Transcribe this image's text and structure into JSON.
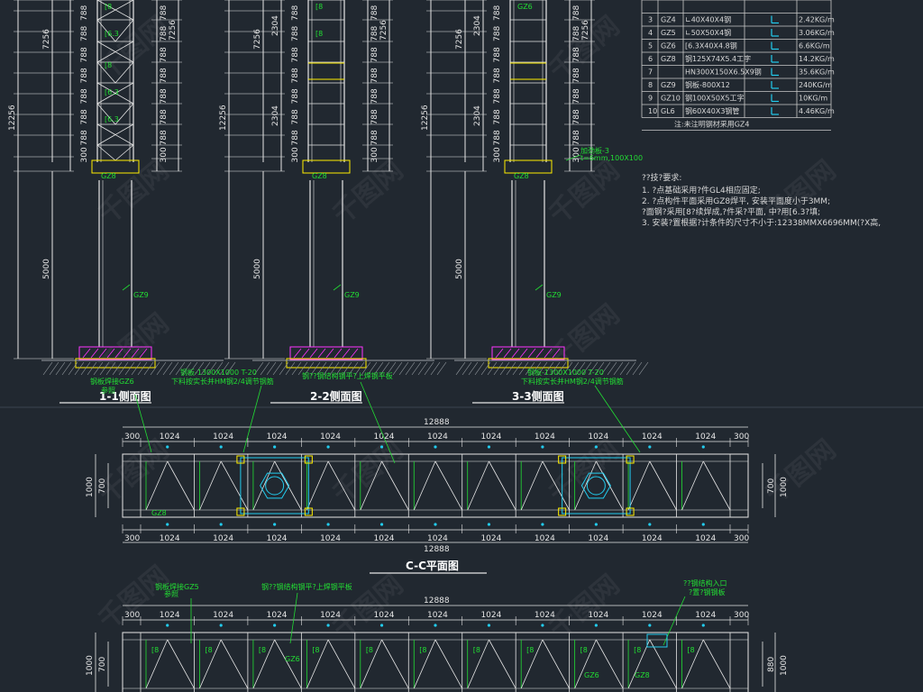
{
  "elevations": [
    {
      "id": "e1",
      "title": "1-1侧面图",
      "total": "12256",
      "upper": "7256",
      "lower": "5000",
      "col_label": "GZ9",
      "base_label": "GZ8",
      "marks": [
        "788",
        "788",
        "788",
        "788",
        "788",
        "788",
        "788",
        "300"
      ],
      "flanges": [
        "[8",
        "[6.3",
        "[8",
        "[6.3",
        "[6.3"
      ]
    },
    {
      "id": "e2",
      "title": "2-2侧面图",
      "total": "12256",
      "upper": "7256",
      "lower": "5000",
      "col_label": "GZ9",
      "base_label": "GZ8",
      "marks": [
        "788",
        "788",
        "788",
        "788",
        "788",
        "788",
        "788",
        "300"
      ],
      "seg_a": "2304",
      "seg_b": "2304",
      "flanges": [
        "[8",
        "[8"
      ]
    },
    {
      "id": "e3",
      "title": "3-3侧面图",
      "total": "12256",
      "upper": "7256",
      "lower": "5000",
      "col_label": "GZ9",
      "base_label": "GZ8",
      "marks": [
        "788",
        "788",
        "788",
        "788",
        "788",
        "788",
        "788",
        "300"
      ],
      "seg_a": "2304",
      "seg_b": "2304",
      "flanges": [
        "GZ6"
      ],
      "callout": "加劲板-3",
      "callout2": "t=6mm,100X100"
    }
  ],
  "table": {
    "rows": [
      {
        "no": "",
        "code": "",
        "spec": "",
        "unit": ""
      },
      {
        "no": "3",
        "code": "GZ4",
        "spec": "∟40X40X4钢",
        "unit": "2.42KG/m"
      },
      {
        "no": "4",
        "code": "GZ5",
        "spec": "∟50X50X4钢",
        "unit": "3.06KG/m"
      },
      {
        "no": "5",
        "code": "GZ6",
        "spec": "[6.3X40X4.8钢",
        "unit": "6.6KG/m"
      },
      {
        "no": "6",
        "code": "GZ8",
        "spec": "钢125X74X5.4工字",
        "unit": "14.2KG/m"
      },
      {
        "no": "7",
        "code": "",
        "spec": "HN300X150X6.5X9钢",
        "unit": "35.6KG/m"
      },
      {
        "no": "8",
        "code": "GZ9",
        "spec": "钢板-800X12",
        "unit": "240KG/m"
      },
      {
        "no": "9",
        "code": "GZ10",
        "spec": "钢100X50X5工字",
        "unit": "10KG/m"
      },
      {
        "no": "10",
        "code": "GL6",
        "spec": "钢60X40X3钢管",
        "unit": "4.46KG/m"
      }
    ],
    "footer": "注:未注明钢材采用GZ4"
  },
  "notes": {
    "heading": "??技?要求:",
    "lines": [
      "1. ?点基础采用?件GL4相应固定;",
      "2. ?点构件平面采用GZ8焊平, 安装平面度小于3MM;",
      "   ?面钢?采用[8?续焊成,?件采?平面, 中?用[6.3?填;",
      "3. 安装?置根据?计条件的尺寸不小于:12338MMX6696MM(?X高,"
    ]
  },
  "plans": [
    {
      "id": "p1",
      "title": "C-C平面图",
      "total": "12888",
      "left_end": "300",
      "right_end": "300",
      "bay": "1024",
      "bays": 11,
      "height_outer": "1000",
      "height_inner": "700",
      "label_tl": "钢板焊接GZ6",
      "label_tl2": "参照",
      "label_mid1": "钢板-1300X1000 T-20",
      "label_mid1b": "下料按实长并HM钢2/4调节钢筋",
      "label_mid2": "钢??钢结构钢平?上焊钢平板",
      "label_mid3": "钢板-1300X1000 T-20",
      "label_mid3b": "下料按实长并HM钢2/4调节钢筋",
      "label_bl": "GZ8"
    },
    {
      "id": "p2",
      "title": "",
      "total": "12888",
      "left_end": "300",
      "right_end": "300",
      "bay": "1024",
      "bays": 11,
      "height_outer": "1000",
      "height_inner": "700",
      "height_right": "880",
      "label_tl": "钢板焊接GZ5",
      "label_tl2": "参照",
      "label_mid2": "钢??钢结构钢平?上焊钢平板",
      "label_tr": "??钢结构入口",
      "label_tr2": "?置?钢钢板",
      "flange": "[8",
      "gz6": "GZ6",
      "gz8": "GZ8"
    }
  ],
  "watermark": "千图网",
  "colors": {
    "bg": "#212830",
    "white": "#e6e6e6",
    "green": "#22dd33",
    "yellow": "#ffee00",
    "magenta": "#ff33ff",
    "cyan": "#22ccee",
    "table": "#c9c9c9",
    "ground": "#9aa0a6"
  }
}
